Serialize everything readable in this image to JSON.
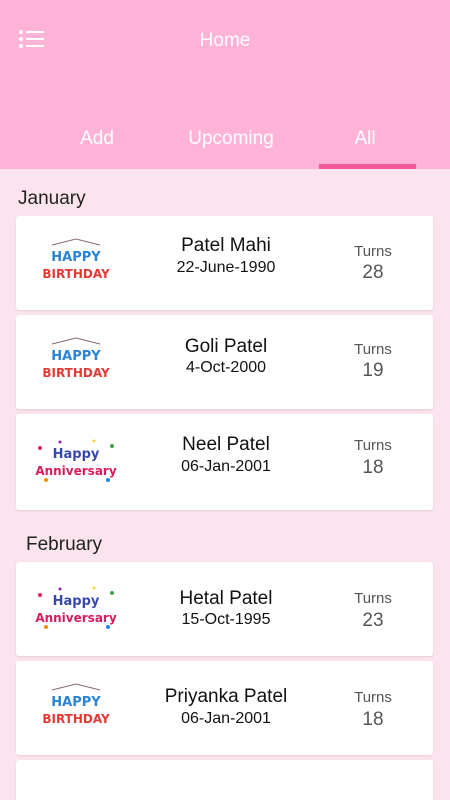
{
  "header": {
    "title": "Home",
    "menu_icon": "list-menu-icon"
  },
  "tabs": [
    {
      "label": "Add"
    },
    {
      "label": "Upcoming"
    },
    {
      "label": "All",
      "active": true
    }
  ],
  "colors": {
    "appbar": "#ffb3d7",
    "indicator": "#f2589a",
    "background": "#fce4ef"
  },
  "sections": [
    {
      "month": "January",
      "items": [
        {
          "badge": "happy-birthday",
          "badge_line1": "HAPPY",
          "badge_line2": "BIRTHDAY",
          "name": "Patel Mahi",
          "date": "22-June-1990",
          "turns_label": "Turns",
          "turns": "28"
        },
        {
          "badge": "happy-birthday",
          "badge_line1": "HAPPY",
          "badge_line2": "BIRTHDAY",
          "name": "Goli Patel",
          "date": "4-Oct-2000",
          "turns_label": "Turns",
          "turns": "19"
        },
        {
          "badge": "happy-anniversary",
          "badge_line1": "Happy",
          "badge_line2": "Anniversary",
          "name": "Neel Patel",
          "date": "06-Jan-2001",
          "turns_label": "Turns",
          "turns": "18"
        }
      ]
    },
    {
      "month": "February",
      "items": [
        {
          "badge": "happy-anniversary",
          "badge_line1": "Happy",
          "badge_line2": "Anniversary",
          "name": "Hetal Patel",
          "date": "15-Oct-1995",
          "turns_label": "Turns",
          "turns": "23"
        },
        {
          "badge": "happy-birthday",
          "badge_line1": "HAPPY",
          "badge_line2": "BIRTHDAY",
          "name": "Priyanka Patel",
          "date": "06-Jan-2001",
          "turns_label": "Turns",
          "turns": "18"
        }
      ]
    }
  ]
}
